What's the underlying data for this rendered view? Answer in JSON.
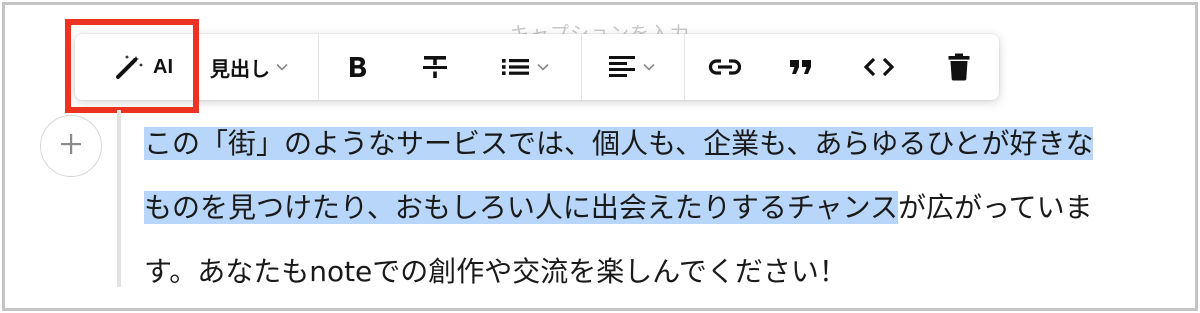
{
  "editor": {
    "caption_placeholder": "キャプションを入力"
  },
  "toolbar": {
    "ai_label": "AI",
    "heading_label": "見出し",
    "bold_icon": "bold-icon",
    "strikethrough_icon": "strikethrough-icon",
    "list_icon": "bulleted-list-icon",
    "align_icon": "align-left-icon",
    "link_icon": "link-icon",
    "quote_icon": "quote-icon",
    "code_icon": "code-icon",
    "delete_icon": "trash-icon"
  },
  "highlight": {
    "color": "#ec3323"
  },
  "body": {
    "line1_selected": "この「街」のようなサービスでは、個人も、企業も、あらゆるひとが好きな",
    "line2_selected": "ものを見つけたり、おもしろい人に出会えたりするチャンス",
    "line2_rest": "が広がっていま",
    "line3": "す。あなたもnoteでの創作や交流を楽しんでください！",
    "selection_color": "#b7d6f9"
  }
}
